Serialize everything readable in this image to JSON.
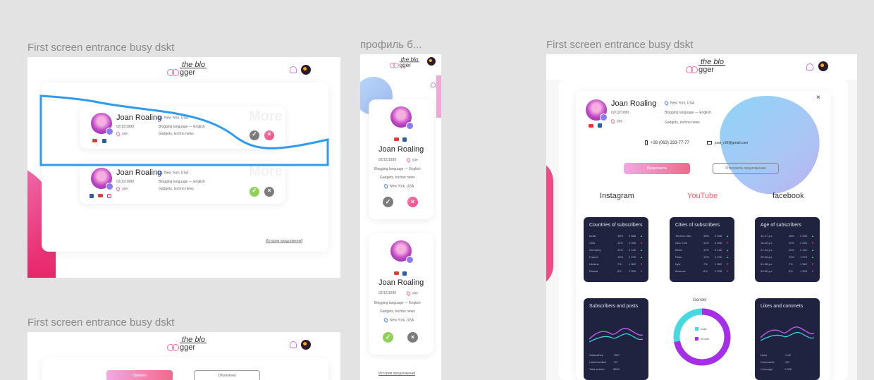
{
  "frames": {
    "left_top": "First screen entrance busy dskt",
    "middle": "профиль б...",
    "right": "First screen entrance busy dskt",
    "left_bottom": "First screen entrance busy dskt"
  },
  "logo": {
    "line1": "the blo",
    "line2": "gger"
  },
  "profile": {
    "name": "Joan Roaling",
    "date": "02/12/1999",
    "gender_short": "she",
    "city": "New York, USA",
    "language": "Blogging language — English",
    "topics": "Gadgets, techno news",
    "phone": "+38 (063) 333-77-77",
    "email": "joan_r99@gmail.com"
  },
  "ghost_label": "More",
  "history_link": "История предложений",
  "buttons": {
    "accept": "Предложить",
    "reject": "Отклонить предложение",
    "left_bottom_accept": "Принято",
    "left_bottom_reject": "Отклонено"
  },
  "close_glyph": "×",
  "tabs": {
    "instagram": "Instagram",
    "youtube": "YouTube",
    "facebook": "facebook"
  },
  "stats": {
    "countries": {
      "title": "Countries of subscribers",
      "rows": [
        {
          "k": "Israel",
          "p": "18%",
          "v": "2 568",
          "d": "up"
        },
        {
          "k": "USA",
          "p": "11%",
          "v": "2 296",
          "d": "dn"
        },
        {
          "k": "Germany",
          "p": "11%",
          "v": "2 140",
          "d": "up"
        },
        {
          "k": "France",
          "p": "10%",
          "v": "1 976",
          "d": "up"
        },
        {
          "k": "Ukraine",
          "p": "7%",
          "v": "1 362",
          "d": "dn"
        },
        {
          "k": "Russia",
          "p": "6%",
          "v": "1 328",
          "d": "dn"
        }
      ]
    },
    "cities": {
      "title": "Cities of subscribers",
      "rows": [
        {
          "k": "Tel Aviv-Yafo",
          "p": "18%",
          "v": "2 548",
          "d": "up"
        },
        {
          "k": "New York",
          "p": "11%",
          "v": "2 296",
          "d": "dn"
        },
        {
          "k": "Berlin",
          "p": "11%",
          "v": "2 140",
          "d": "up"
        },
        {
          "k": "Paris",
          "p": "10%",
          "v": "1 976",
          "d": "up"
        },
        {
          "k": "Kyiv",
          "p": "7%",
          "v": "1 362",
          "d": "dn"
        },
        {
          "k": "Moscow",
          "p": "6%",
          "v": "1 328",
          "d": "dn"
        }
      ]
    },
    "age": {
      "title": "Age of subscribers",
      "rows": [
        {
          "k": "14-17 y.o.",
          "p": "18%",
          "v": "2 548",
          "d": "up"
        },
        {
          "k": "18-20 y.o.",
          "p": "11%",
          "v": "2 296",
          "d": "dn"
        },
        {
          "k": "21-24 y.o.",
          "p": "11%",
          "v": "2 140",
          "d": "up"
        },
        {
          "k": "25-30 y.o.",
          "p": "10%",
          "v": "1 976",
          "d": "up"
        },
        {
          "k": "31-38 y.o.",
          "p": "7%",
          "v": "1 362",
          "d": "dn"
        },
        {
          "k": "39-50 y.o.",
          "p": "6%",
          "v": "1 328",
          "d": "dn"
        }
      ]
    },
    "subs_posts": {
      "title": "Subscribers and posts",
      "rows": [
        {
          "k": "Subscribes",
          "v": "+857"
        },
        {
          "k": "Unsubscribes",
          "v": "+57"
        },
        {
          "k": "Total subscr.",
          "v": "3654"
        }
      ]
    },
    "likes": {
      "title": "Likes and commets",
      "rows": [
        {
          "k": "Likes",
          "v": "+120"
        },
        {
          "k": "Comments",
          "v": "+53"
        },
        {
          "k": "Coverage",
          "v": "1 009"
        }
      ]
    },
    "gender": {
      "title": "Gender",
      "male": "male",
      "female": "female",
      "female_share": 0.72
    }
  },
  "colors": {
    "accent_pink": "#f06aa8",
    "accent_blue": "#2f9bf0",
    "dark_card": "#1f2340",
    "youtube_red": "#f05a6a"
  }
}
